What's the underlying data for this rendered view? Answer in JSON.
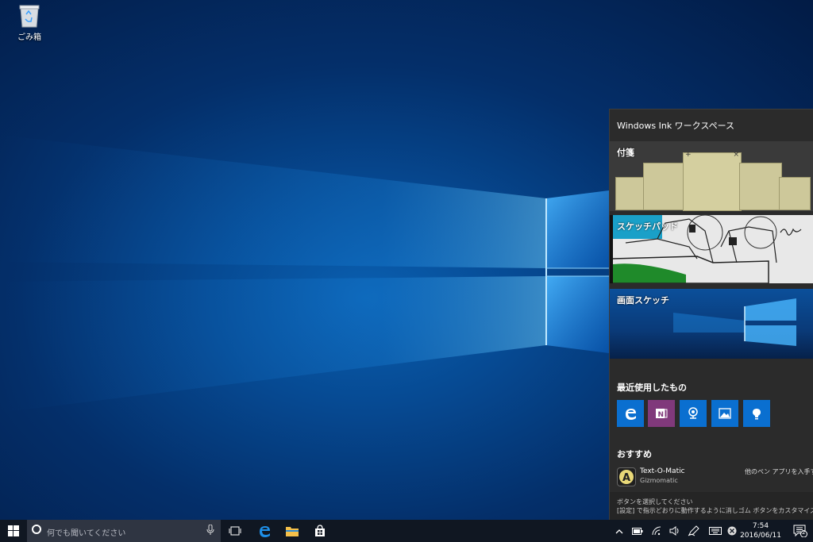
{
  "desktop": {
    "recycle_bin_label": "ごみ箱"
  },
  "ink_workspace": {
    "title": "Windows Ink ワークスペース",
    "sticky_notes_label": "付箋",
    "sketchpad_label": "スケッチパッド",
    "screen_sketch_label": "画面スケッチ",
    "recent_label": "最近使用したもの",
    "recent_apps": [
      "edge-icon",
      "onenote-icon",
      "maps-icon",
      "photos-icon",
      "tips-icon"
    ],
    "suggested_label": "おすすめ",
    "suggested_app": {
      "name": "Text-O-Matic",
      "publisher": "Gizmomatic",
      "get_pen_apps": "他のペン アプリを入手する"
    },
    "footer_line1": "ボタンを選択してください",
    "footer_line2": "[設定] で指示どおりに動作するように消しゴム ボタンをカスタマイズできます"
  },
  "taskbar": {
    "search_placeholder": "何でも聞いてください",
    "time": "7:54",
    "date": "2016/06/11",
    "notification_count": "2"
  },
  "colors": {
    "accent": "#0a6fd0",
    "taskbar": "#101722",
    "panel": "#2b2b2b"
  }
}
